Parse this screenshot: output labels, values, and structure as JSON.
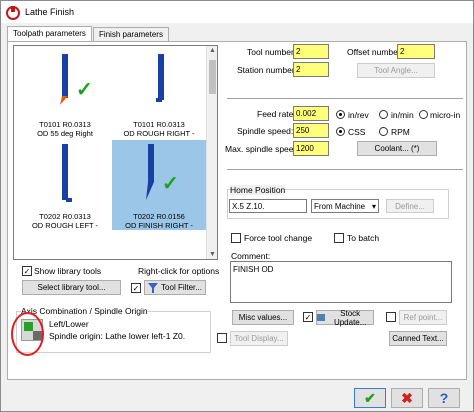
{
  "window": {
    "title": "Lathe Finish"
  },
  "tabs": [
    {
      "label": "Toolpath parameters"
    },
    {
      "label": "Finish parameters"
    }
  ],
  "tools": [
    {
      "line1": "T0101 R0.0313",
      "line2": "OD 55 deg Right",
      "checked": true
    },
    {
      "line1": "T0101 R0.0313",
      "line2": "OD ROUGH RIGHT -",
      "checked": false
    },
    {
      "line1": "T0202 R0.0313",
      "line2": "OD ROUGH LEFT -",
      "checked": false
    },
    {
      "line1": "T0202 R0.0156",
      "line2": "OD FINISH RIGHT -",
      "checked": true
    }
  ],
  "left": {
    "show_library_tools": "Show library tools",
    "right_click": "Right-click for options",
    "select_library_tool": "Select library tool...",
    "tool_filter": "Tool Filter..."
  },
  "axis": {
    "title": "Axis Combination / Spindle Origin",
    "left_lower": "Left/Lower",
    "spindle_origin": "Spindle origin: Lathe lower left-1   Z0."
  },
  "fields": {
    "tool_number_label": "Tool number:",
    "tool_number": "2",
    "offset_number_label": "Offset number:",
    "offset_number": "2",
    "station_number_label": "Station number:",
    "station_number": "2",
    "tool_angle": "Tool Angle...",
    "feed_rate_label": "Feed rate:",
    "feed_rate": "0.002",
    "in_rev": "in/rev",
    "in_min": "in/min",
    "micro_in": "micro-in",
    "spindle_speed_label": "Spindle speed:",
    "spindle_speed": "250",
    "css": "CSS",
    "rpm": "RPM",
    "max_spindle_label": "Max. spindle speed:",
    "max_spindle": "1200",
    "coolant": "Coolant... (*)"
  },
  "home": {
    "title": "Home Position",
    "coords": "X.5  Z.10.",
    "from_machine": "From Machine",
    "define": "Define..."
  },
  "options": {
    "force_tool_change": "Force tool change",
    "to_batch": "To batch"
  },
  "comment": {
    "label": "Comment:",
    "text": "FINISH OD"
  },
  "buttons": {
    "misc_values": "Misc values...",
    "stock_update": "Stock Update...",
    "ref_point": "Ref point...",
    "tool_display": "Tool Display...",
    "canned_text": "Canned Text..."
  },
  "bottom": {
    "ok": "✔",
    "cancel": "✖",
    "help": "?"
  },
  "colors": {
    "field_highlight": "#ffff7a",
    "selected_tool": "#9cc6e8",
    "insert": "#1a3fa8",
    "tip": "#e06010",
    "check": "#1fa01f",
    "annotation": "#e02020"
  }
}
